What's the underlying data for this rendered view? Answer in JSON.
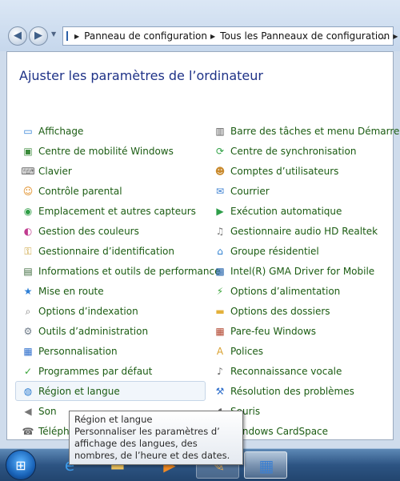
{
  "breadcrumb": {
    "items": [
      "Panneau de configuration",
      "Tous les Panneaux de configuration"
    ]
  },
  "page": {
    "title": "Ajuster les paramètres de l’ordinateur"
  },
  "left_items": [
    {
      "label": "Affichage",
      "icon": "display-icon"
    },
    {
      "label": "Centre de mobilité Windows",
      "icon": "mobility-center-icon"
    },
    {
      "label": "Clavier",
      "icon": "keyboard-icon"
    },
    {
      "label": "Contrôle parental",
      "icon": "parental-control-icon"
    },
    {
      "label": "Emplacement et autres capteurs",
      "icon": "location-sensor-icon"
    },
    {
      "label": "Gestion des couleurs",
      "icon": "color-management-icon"
    },
    {
      "label": "Gestionnaire d’identification",
      "icon": "credential-manager-icon"
    },
    {
      "label": "Informations et outils de performance",
      "icon": "performance-icon"
    },
    {
      "label": "Mise en route",
      "icon": "getting-started-icon"
    },
    {
      "label": "Options d’indexation",
      "icon": "indexing-icon"
    },
    {
      "label": "Outils d’administration",
      "icon": "admin-tools-icon"
    },
    {
      "label": "Personnalisation",
      "icon": "personalization-icon"
    },
    {
      "label": "Programmes par défaut",
      "icon": "default-programs-icon"
    },
    {
      "label": "Région et langue",
      "icon": "region-language-icon"
    },
    {
      "label": "Son",
      "icon": "sound-icon"
    },
    {
      "label": "Téléphone",
      "icon": "phone-modem-icon"
    }
  ],
  "right_items": [
    {
      "label": "Barre des tâches et menu Démarrer",
      "icon": "taskbar-icon"
    },
    {
      "label": "Centre de synchronisation",
      "icon": "sync-center-icon"
    },
    {
      "label": "Comptes d’utilisateurs",
      "icon": "user-accounts-icon"
    },
    {
      "label": "Courrier",
      "icon": "mail-icon"
    },
    {
      "label": "Exécution automatique",
      "icon": "autoplay-icon"
    },
    {
      "label": "Gestionnaire audio HD Realtek",
      "icon": "realtek-audio-icon"
    },
    {
      "label": "Groupe résidentiel",
      "icon": "homegroup-icon"
    },
    {
      "label": "Intel(R) GMA Driver for Mobile",
      "icon": "intel-gma-icon"
    },
    {
      "label": "Options d’alimentation",
      "icon": "power-options-icon"
    },
    {
      "label": "Options des dossiers",
      "icon": "folder-options-icon"
    },
    {
      "label": "Pare-feu Windows",
      "icon": "firewall-icon"
    },
    {
      "label": "Polices",
      "icon": "fonts-icon"
    },
    {
      "label": "Reconnaissance vocale",
      "icon": "speech-recognition-icon"
    },
    {
      "label": "Résolution des problèmes",
      "icon": "troubleshooting-icon"
    },
    {
      "label": "Souris",
      "icon": "mouse-icon"
    },
    {
      "label": "Windows CardSpace",
      "icon": "cardspace-icon"
    }
  ],
  "tooltip": {
    "title": "Région et langue",
    "description": "Personnaliser les paramètres d’ affichage des langues, des nombres, de l’heure et des dates."
  },
  "taskbar": {
    "buttons": [
      "start-orb",
      "internet-explorer",
      "windows-explorer",
      "media-player",
      "paint",
      "control-panel"
    ]
  },
  "colors": {
    "link_green": "#1b5c12",
    "title_blue": "#1e3287"
  }
}
